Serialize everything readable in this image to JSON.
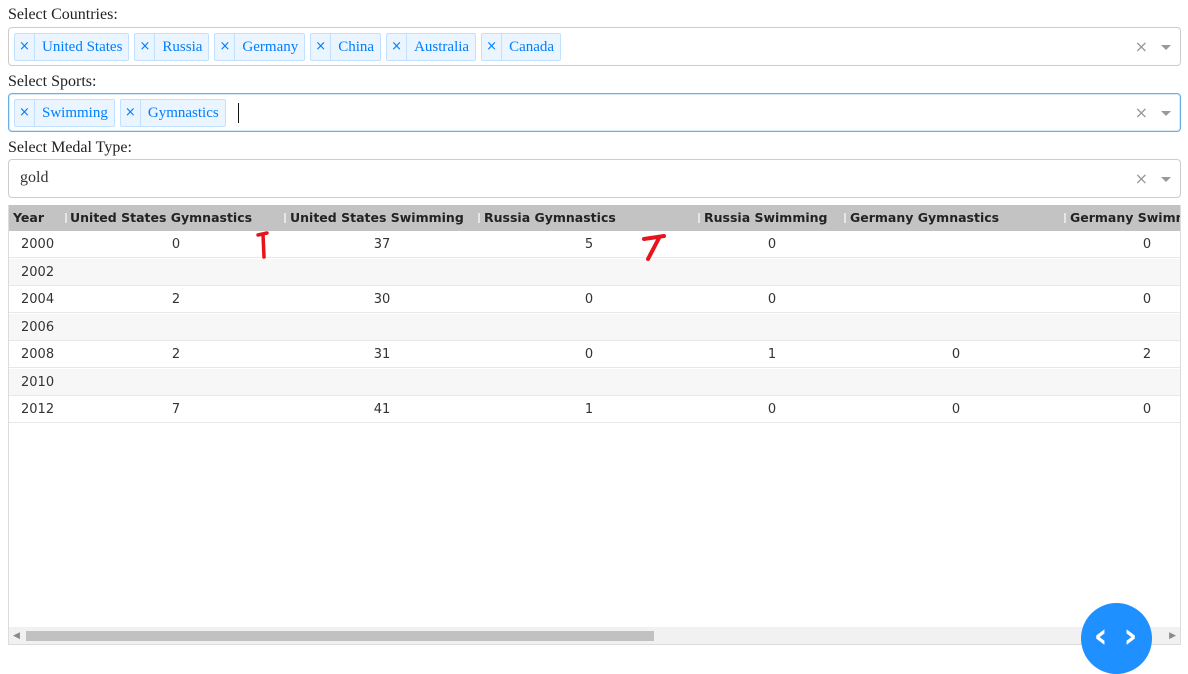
{
  "filters": {
    "countries_label": "Select Countries:",
    "countries": [
      "United States",
      "Russia",
      "Germany",
      "China",
      "Australia",
      "Canada"
    ],
    "sports_label": "Select Sports:",
    "sports": [
      "Swimming",
      "Gymnastics"
    ],
    "medal_label": "Select Medal Type:",
    "medal_value": "gold",
    "remove_glyph": "×",
    "clear_glyph": "×"
  },
  "table": {
    "columns": [
      "Year",
      "United States Gymnastics",
      "United States Swimming",
      "Russia Gymnastics",
      "Russia Swimming",
      "Germany Gymnastics",
      "Germany Swimming"
    ],
    "rows": [
      [
        "2000",
        "0",
        "37",
        "5",
        "0",
        "",
        "0"
      ],
      [
        "2002",
        "",
        "",
        "",
        "",
        "",
        ""
      ],
      [
        "2004",
        "2",
        "30",
        "0",
        "0",
        "",
        "0"
      ],
      [
        "2006",
        "",
        "",
        "",
        "",
        "",
        ""
      ],
      [
        "2008",
        "2",
        "31",
        "0",
        "1",
        "0",
        "2"
      ],
      [
        "2010",
        "",
        "",
        "",
        "",
        "",
        ""
      ],
      [
        "2012",
        "7",
        "41",
        "1",
        "0",
        "0",
        "0"
      ]
    ]
  },
  "scroll": {
    "left_arrow": "◀",
    "right_arrow": "▶"
  },
  "fab": {
    "glyph": "‹ ›"
  },
  "colors": {
    "accent": "#007eff",
    "chip_bg": "#ebf5ff",
    "header_bg": "#c3c3c3",
    "fab": "#1e90ff",
    "annotation": "#e8141c"
  }
}
